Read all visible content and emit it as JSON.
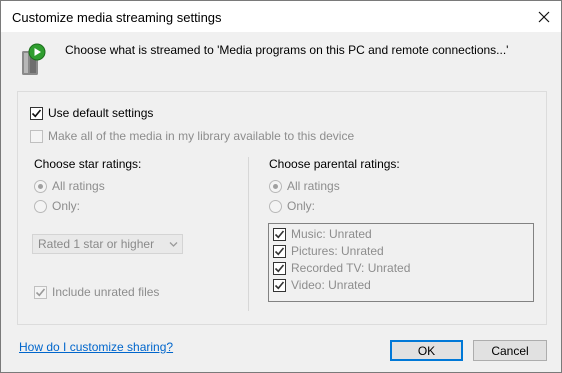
{
  "window": {
    "title": "Customize media streaming settings",
    "close_icon": "close-icon"
  },
  "header": {
    "icon": "media-sharing-icon",
    "text": "Choose what is streamed to 'Media programs on this PC and remote connections...'"
  },
  "general": {
    "use_default": {
      "label": "Use default settings",
      "checked": true
    },
    "make_all": {
      "label": "Make all of the media in my library available to this device",
      "checked": false,
      "disabled": true
    }
  },
  "star": {
    "heading": "Choose star ratings:",
    "all_label": "All ratings",
    "only_label": "Only:",
    "select_value": "Rated 1 star or higher",
    "include_unrated_label": "Include unrated files"
  },
  "parental": {
    "heading": "Choose parental ratings:",
    "all_label": "All ratings",
    "only_label": "Only:",
    "items": [
      {
        "label": "Music: Unrated",
        "checked": true
      },
      {
        "label": "Pictures: Unrated",
        "checked": true
      },
      {
        "label": "Recorded TV: Unrated",
        "checked": true
      },
      {
        "label": "Video: Unrated",
        "checked": true
      }
    ]
  },
  "footer": {
    "link": "How do I customize sharing?",
    "ok": "OK",
    "cancel": "Cancel"
  },
  "colors": {
    "accent": "#0078d7",
    "link": "#0066cc",
    "disabled_text": "#8d8d8d",
    "window_bg": "#f0f0f0"
  }
}
